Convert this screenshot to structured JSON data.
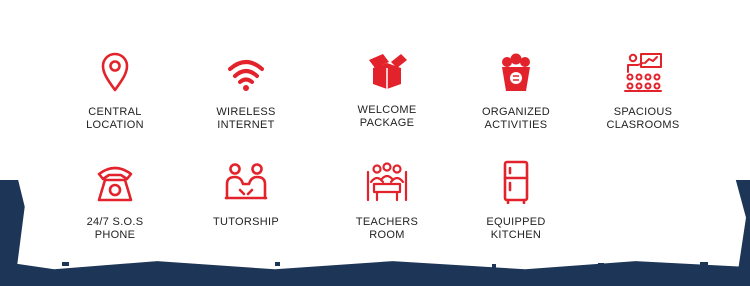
{
  "amenities": [
    {
      "label": "CENTRAL\nLOCATION",
      "icon": "map-pin-icon"
    },
    {
      "label": "WIRELESS\nINTERNET",
      "icon": "wifi-icon"
    },
    {
      "label": "WELCOME\nPACKAGE",
      "icon": "package-box-icon"
    },
    {
      "label": "ORGANIZED\nACTIVITIES",
      "icon": "popcorn-icon"
    },
    {
      "label": "SPACIOUS\nCLASROOMS",
      "icon": "classroom-icon"
    },
    {
      "label": "24/7 S.O.S\nPHONE",
      "icon": "telephone-icon"
    },
    {
      "label": "TUTORSHIP",
      "icon": "tutor-meeting-icon"
    },
    {
      "label": "TEACHERS\nROOM",
      "icon": "teachers-room-icon"
    },
    {
      "label": "EQUIPPED\nKITCHEN",
      "icon": "refrigerator-icon"
    }
  ],
  "colors": {
    "accent": "#e3232c",
    "backdrop": "#1d3557",
    "text": "#222222"
  }
}
